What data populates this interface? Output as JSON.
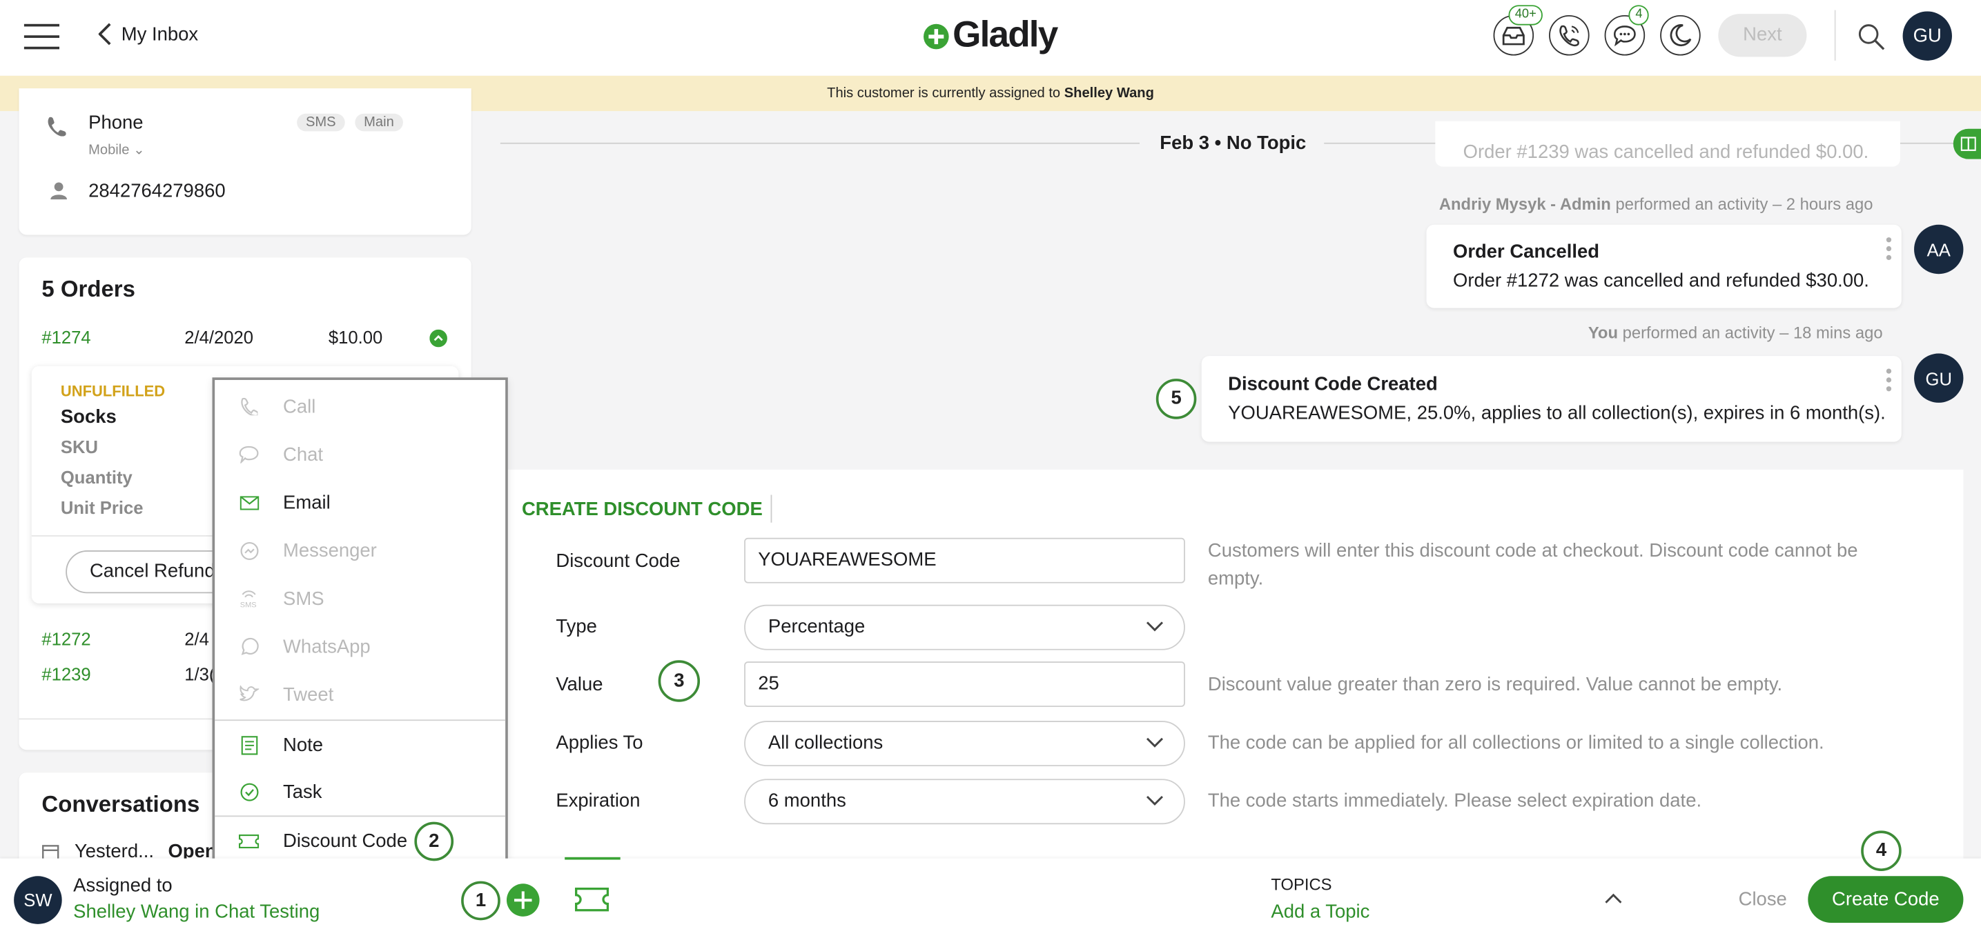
{
  "header": {
    "back_label": "My Inbox",
    "brand": "Gladly",
    "inbox_badge": "40+",
    "chat_badge": "4",
    "next_label": "Next",
    "user_initials": "GU"
  },
  "banner": {
    "text": "This customer is currently assigned to",
    "assignee": "Shelley Wang"
  },
  "contact": {
    "phone_label": "Phone",
    "phone_tags": [
      "SMS",
      "Main"
    ],
    "phone_type": "Mobile",
    "phone_number": "2842764279860"
  },
  "orders": {
    "title": "5 Orders",
    "rows": [
      {
        "id": "#1274",
        "date": "2/4/2020",
        "amount": "$10.00"
      },
      {
        "id": "#1272",
        "date": "2/4"
      },
      {
        "id": "#1239",
        "date": "1/3("
      }
    ],
    "detail": {
      "status": "UNFULFILLED",
      "item": "Socks",
      "fields": [
        "SKU",
        "Quantity",
        "Unit Price"
      ],
      "cancel_label": "Cancel Refund"
    }
  },
  "conversations": {
    "title": "Conversations",
    "item_date": "Yesterd...",
    "item_status": "Open"
  },
  "menu": {
    "items": [
      {
        "label": "Call",
        "icon": "phone-icon",
        "disabled": true
      },
      {
        "label": "Chat",
        "icon": "chat-icon",
        "disabled": true
      },
      {
        "label": "Email",
        "icon": "email-icon",
        "disabled": false
      },
      {
        "label": "Messenger",
        "icon": "messenger-icon",
        "disabled": true
      },
      {
        "label": "SMS",
        "icon": "sms-icon",
        "disabled": true
      },
      {
        "label": "WhatsApp",
        "icon": "whatsapp-icon",
        "disabled": true
      },
      {
        "label": "Tweet",
        "icon": "tweet-icon",
        "disabled": true
      },
      {
        "label": "Note",
        "icon": "note-icon",
        "disabled": false
      },
      {
        "label": "Task",
        "icon": "task-icon",
        "disabled": false
      },
      {
        "label": "Discount Code",
        "icon": "discount-icon",
        "disabled": false
      }
    ]
  },
  "timeline": {
    "divider": "Feb 3 • No Topic",
    "cut_text": "Order #1239 was cancelled and refunded $0.00.",
    "activities": [
      {
        "actor": "Andriy Mysyk - Admin",
        "meta": "performed an activity – 2 hours ago",
        "title": "Order Cancelled",
        "body": "Order #1272 was cancelled and refunded $30.00.",
        "avatar": "AA"
      },
      {
        "actor": "You",
        "meta": "performed an activity – 18 mins ago",
        "title": "Discount Code Created",
        "body": "YOUAREAWESOME, 25.0%, applies to all collection(s), expires in 6 month(s).",
        "avatar": "GU"
      }
    ]
  },
  "discount_form": {
    "heading": "CREATE DISCOUNT CODE",
    "code_label": "Discount Code",
    "code_value": "YOUAREAWESOME",
    "code_hint": "Customers will enter this discount code at checkout. Discount code cannot be empty.",
    "type_label": "Type",
    "type_value": "Percentage",
    "value_label": "Value",
    "value_value": "25",
    "value_hint": "Discount value greater than zero is required. Value cannot be empty.",
    "applies_label": "Applies To",
    "applies_value": "All collections",
    "applies_hint": "The code can be applied for all collections or limited to a single collection.",
    "expiration_label": "Expiration",
    "expiration_value": "6 months",
    "expiration_hint": "The code starts immediately. Please select expiration date."
  },
  "footer": {
    "assigned_initials": "SW",
    "assigned_label": "Assigned to",
    "assigned_value": "Shelley Wang in Chat Testing",
    "topics_label": "TOPICS",
    "topics_action": "Add a Topic",
    "close_label": "Close",
    "create_label": "Create Code"
  },
  "callouts": [
    "1",
    "2",
    "3",
    "4",
    "5"
  ],
  "colors": {
    "brand_green": "#3aa335",
    "dark_navy": "#18293f",
    "banner": "#f8edc8"
  }
}
